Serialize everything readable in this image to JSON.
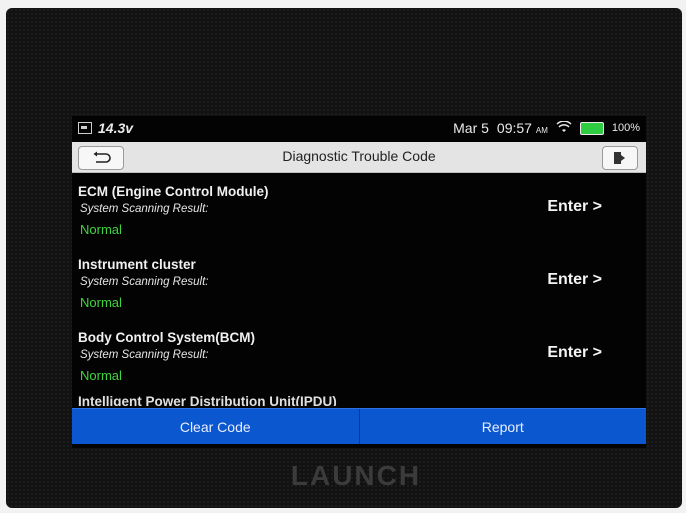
{
  "status_bar": {
    "voltage": "14.3v",
    "date": "Mar 5",
    "time": "09:57",
    "time_suffix": "AM",
    "battery": "100%"
  },
  "header": {
    "title": "Diagnostic Trouble Code"
  },
  "systems": [
    {
      "name": "ECM (Engine Control Module)",
      "sublabel": "System Scanning Result:",
      "status": "Normal",
      "action": "Enter >"
    },
    {
      "name": "Instrument cluster",
      "sublabel": "System Scanning Result:",
      "status": "Normal",
      "action": "Enter >"
    },
    {
      "name": "Body Control System(BCM)",
      "sublabel": "System Scanning Result:",
      "status": "Normal",
      "action": "Enter >"
    }
  ],
  "partial_system": "Intelligent Power Distribution Unit(IPDU)",
  "footer": {
    "clear_label": "Clear Code",
    "report_label": "Report"
  },
  "device": {
    "brand": "LAUNCH"
  },
  "colors": {
    "status_ok": "#3fd63f",
    "footer_blue": "#0b57d0",
    "battery": "#2ecc40"
  }
}
